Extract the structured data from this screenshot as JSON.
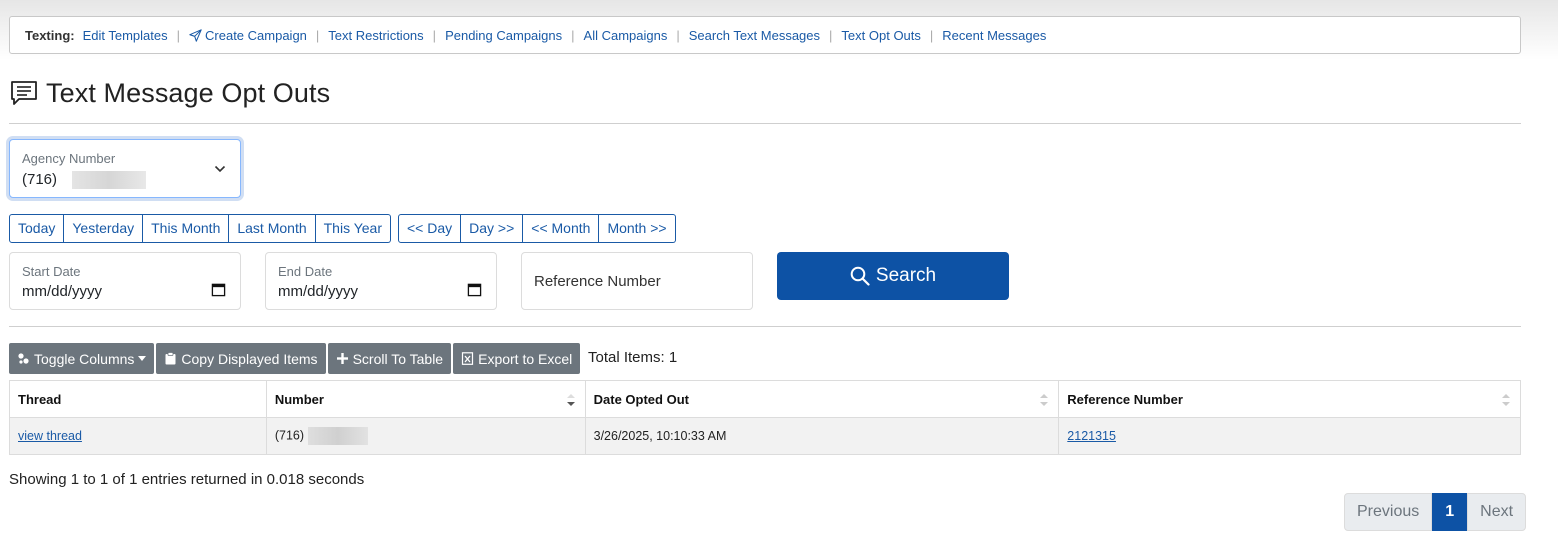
{
  "nav": {
    "label": "Texting:",
    "items": [
      {
        "label": "Edit Templates"
      },
      {
        "label": "Create Campaign",
        "icon": "send-icon"
      },
      {
        "label": "Text Restrictions"
      },
      {
        "label": "Pending Campaigns"
      },
      {
        "label": "All Campaigns"
      },
      {
        "label": "Search Text Messages"
      },
      {
        "label": "Text Opt Outs"
      },
      {
        "label": "Recent Messages"
      }
    ],
    "separator": "|"
  },
  "page": {
    "title": "Text Message Opt Outs",
    "title_icon": "chat-icon"
  },
  "filters": {
    "agency": {
      "label": "Agency Number",
      "value": "(716)"
    },
    "quick_dates": [
      "Today",
      "Yesterday",
      "This Month",
      "Last Month",
      "This Year"
    ],
    "nav_dates": [
      "<< Day",
      "Day >>",
      "<< Month",
      "Month >>"
    ],
    "start_date": {
      "label": "Start Date",
      "value": "mm/dd/yyyy"
    },
    "end_date": {
      "label": "End Date",
      "value": "mm/dd/yyyy"
    },
    "reference": {
      "placeholder": "Reference Number"
    },
    "search_label": "Search"
  },
  "toolbar": {
    "toggle_columns": "Toggle Columns",
    "copy": "Copy Displayed Items",
    "scroll": "Scroll To Table",
    "export": "Export to Excel",
    "total_items": "Total Items: 1"
  },
  "table": {
    "columns": [
      "Thread",
      "Number",
      "Date Opted Out",
      "Reference Number"
    ],
    "rows": [
      {
        "thread": "view thread",
        "number": "(716)",
        "date": "3/26/2025, 10:10:33 AM",
        "reference": "2121315"
      }
    ]
  },
  "footer": {
    "showing": "Showing 1 to 1 of 1 entries returned in 0.018 seconds",
    "pager": {
      "previous": "Previous",
      "page": "1",
      "next": "Next"
    }
  },
  "colors": {
    "primary": "#0d52a5",
    "link": "#1a5aa6",
    "secondary": "#6c757d"
  }
}
